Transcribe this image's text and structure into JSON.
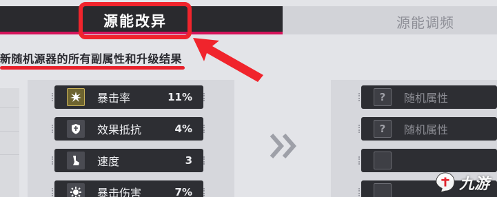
{
  "tabs": {
    "active_label": "源能改异",
    "inactive_label": "源能调频"
  },
  "subtitle": "新随机源器的所有副属性和升级结果",
  "left_stats": [
    {
      "icon": "crit-rate-icon",
      "name": "暴击率",
      "value": "11%",
      "highlight": true
    },
    {
      "icon": "effect-resist-icon",
      "name": "效果抵抗",
      "value": "4%",
      "highlight": false
    },
    {
      "icon": "speed-icon",
      "name": "速度",
      "value": "3",
      "highlight": false
    },
    {
      "icon": "crit-damage-icon",
      "name": "暴击伤害",
      "value": "7%",
      "highlight": false
    }
  ],
  "right_stats": [
    {
      "icon": "question-icon",
      "name": "随机属性",
      "symbol": "?"
    },
    {
      "icon": "question-icon",
      "name": "随机属性",
      "symbol": "?"
    }
  ],
  "watermark": {
    "text": "九游"
  },
  "colors": {
    "accent_red": "#f0242c",
    "tab_dark": "#2a2a2e",
    "row_bg": "#2d2e33"
  }
}
